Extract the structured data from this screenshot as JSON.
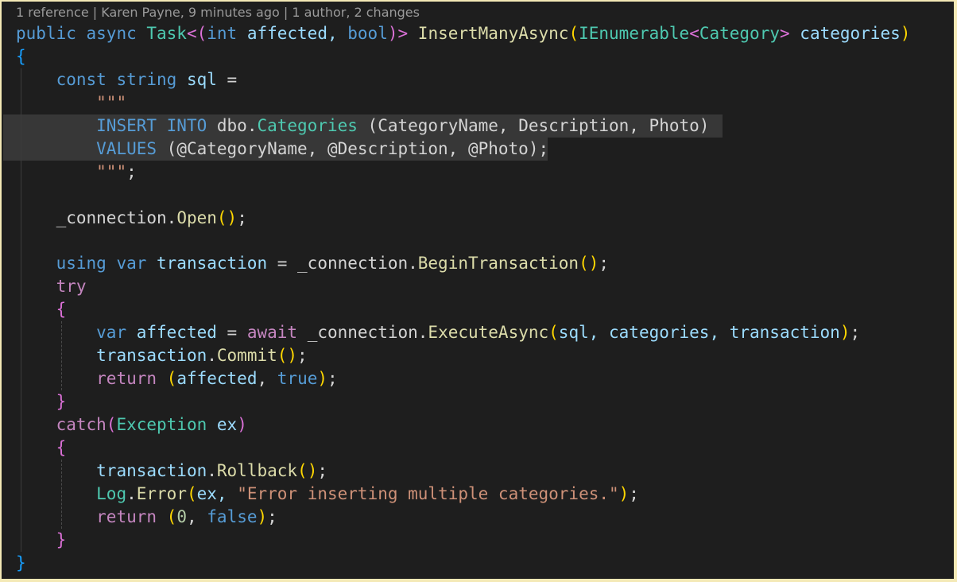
{
  "codelens": "1 reference | Karen Payne, 9 minutes ago | 1 author, 2 changes",
  "colors": {
    "keyword": "#569cd6",
    "control": "#c586c0",
    "type": "#4ec9b0",
    "function": "#dcdcaa",
    "variable": "#9cdcfe",
    "string": "#ce9178",
    "number": "#b5cea8",
    "punct": "#d4d4d4",
    "bracket1": "#ffd700",
    "bracket2": "#da70d6",
    "bracket3": "#179fff"
  },
  "lines": [
    [
      [
        "public ",
        "keyword"
      ],
      [
        "async ",
        "keyword"
      ],
      [
        "Task",
        "type"
      ],
      [
        "<(",
        "bracket2"
      ],
      [
        "int ",
        "keyword"
      ],
      [
        "affected, ",
        "variable"
      ],
      [
        "bool",
        "keyword"
      ],
      [
        ")>",
        "bracket2"
      ],
      [
        " ",
        "punct"
      ],
      [
        "InsertManyAsync",
        "function"
      ],
      [
        "(",
        "bracket1"
      ],
      [
        "IEnumerable",
        "type"
      ],
      [
        "<",
        "bracket2"
      ],
      [
        "Category",
        "type"
      ],
      [
        "> ",
        "bracket2"
      ],
      [
        "categories",
        "variable"
      ],
      [
        ")",
        "bracket1"
      ]
    ],
    [
      [
        "{",
        "bracket3"
      ]
    ],
    [
      [
        "    ",
        "punct"
      ],
      [
        "const ",
        "keyword"
      ],
      [
        "string ",
        "keyword"
      ],
      [
        "sql ",
        "variable"
      ],
      [
        "=",
        "punct"
      ]
    ],
    [
      [
        "        ",
        "punct"
      ],
      [
        "\"\"\"",
        "string"
      ]
    ],
    [
      [
        "        ",
        "punct"
      ],
      [
        "INSERT INTO ",
        "keyword"
      ],
      [
        "dbo",
        "punct"
      ],
      [
        ".",
        "punct"
      ],
      [
        "Categories ",
        "type"
      ],
      [
        "(CategoryName, Description, Photo)",
        "punct"
      ]
    ],
    [
      [
        "        ",
        "punct"
      ],
      [
        "VALUES ",
        "keyword"
      ],
      [
        "(@CategoryName, @Description, @Photo);",
        "punct"
      ]
    ],
    [
      [
        "        ",
        "punct"
      ],
      [
        "\"\"\"",
        "string"
      ],
      [
        ";",
        "punct"
      ]
    ],
    [],
    [
      [
        "    ",
        "punct"
      ],
      [
        "_connection",
        "punct"
      ],
      [
        ".",
        "punct"
      ],
      [
        "Open",
        "function"
      ],
      [
        "()",
        "bracket1"
      ],
      [
        ";",
        "punct"
      ]
    ],
    [],
    [
      [
        "    ",
        "punct"
      ],
      [
        "using ",
        "keyword"
      ],
      [
        "var ",
        "keyword"
      ],
      [
        "transaction ",
        "variable"
      ],
      [
        "= ",
        "punct"
      ],
      [
        "_connection",
        "punct"
      ],
      [
        ".",
        "punct"
      ],
      [
        "BeginTransaction",
        "function"
      ],
      [
        "()",
        "bracket1"
      ],
      [
        ";",
        "punct"
      ]
    ],
    [
      [
        "    ",
        "punct"
      ],
      [
        "try",
        "control"
      ]
    ],
    [
      [
        "    ",
        "punct"
      ],
      [
        "{",
        "bracket2"
      ]
    ],
    [
      [
        "        ",
        "punct"
      ],
      [
        "var ",
        "keyword"
      ],
      [
        "affected ",
        "variable"
      ],
      [
        "= ",
        "punct"
      ],
      [
        "await ",
        "control"
      ],
      [
        "_connection",
        "punct"
      ],
      [
        ".",
        "punct"
      ],
      [
        "ExecuteAsync",
        "function"
      ],
      [
        "(",
        "bracket1"
      ],
      [
        "sql, ",
        "variable"
      ],
      [
        "categories, ",
        "variable"
      ],
      [
        "transaction",
        "variable"
      ],
      [
        ")",
        "bracket1"
      ],
      [
        ";",
        "punct"
      ]
    ],
    [
      [
        "        ",
        "punct"
      ],
      [
        "transaction",
        "variable"
      ],
      [
        ".",
        "punct"
      ],
      [
        "Commit",
        "function"
      ],
      [
        "()",
        "bracket1"
      ],
      [
        ";",
        "punct"
      ]
    ],
    [
      [
        "        ",
        "punct"
      ],
      [
        "return ",
        "control"
      ],
      [
        "(",
        "bracket1"
      ],
      [
        "affected",
        "variable"
      ],
      [
        ", ",
        "punct"
      ],
      [
        "true",
        "keyword"
      ],
      [
        ")",
        "bracket1"
      ],
      [
        ";",
        "punct"
      ]
    ],
    [
      [
        "    ",
        "punct"
      ],
      [
        "}",
        "bracket2"
      ]
    ],
    [
      [
        "    ",
        "punct"
      ],
      [
        "catch",
        "control"
      ],
      [
        "(",
        "bracket2"
      ],
      [
        "Exception ",
        "type"
      ],
      [
        "ex",
        "variable"
      ],
      [
        ")",
        "bracket2"
      ]
    ],
    [
      [
        "    ",
        "punct"
      ],
      [
        "{",
        "bracket2"
      ]
    ],
    [
      [
        "        ",
        "punct"
      ],
      [
        "transaction",
        "variable"
      ],
      [
        ".",
        "punct"
      ],
      [
        "Rollback",
        "function"
      ],
      [
        "()",
        "bracket1"
      ],
      [
        ";",
        "punct"
      ]
    ],
    [
      [
        "        ",
        "punct"
      ],
      [
        "Log",
        "type"
      ],
      [
        ".",
        "punct"
      ],
      [
        "Error",
        "function"
      ],
      [
        "(",
        "bracket1"
      ],
      [
        "ex, ",
        "variable"
      ],
      [
        "\"Error inserting multiple categories.\"",
        "string"
      ],
      [
        ")",
        "bracket1"
      ],
      [
        ";",
        "punct"
      ]
    ],
    [
      [
        "        ",
        "punct"
      ],
      [
        "return ",
        "control"
      ],
      [
        "(",
        "bracket1"
      ],
      [
        "0",
        "number"
      ],
      [
        ", ",
        "punct"
      ],
      [
        "false",
        "keyword"
      ],
      [
        ")",
        "bracket1"
      ],
      [
        ";",
        "punct"
      ]
    ],
    [
      [
        "    ",
        "punct"
      ],
      [
        "}",
        "bracket2"
      ]
    ],
    [
      [
        "}",
        "bracket3"
      ]
    ]
  ]
}
